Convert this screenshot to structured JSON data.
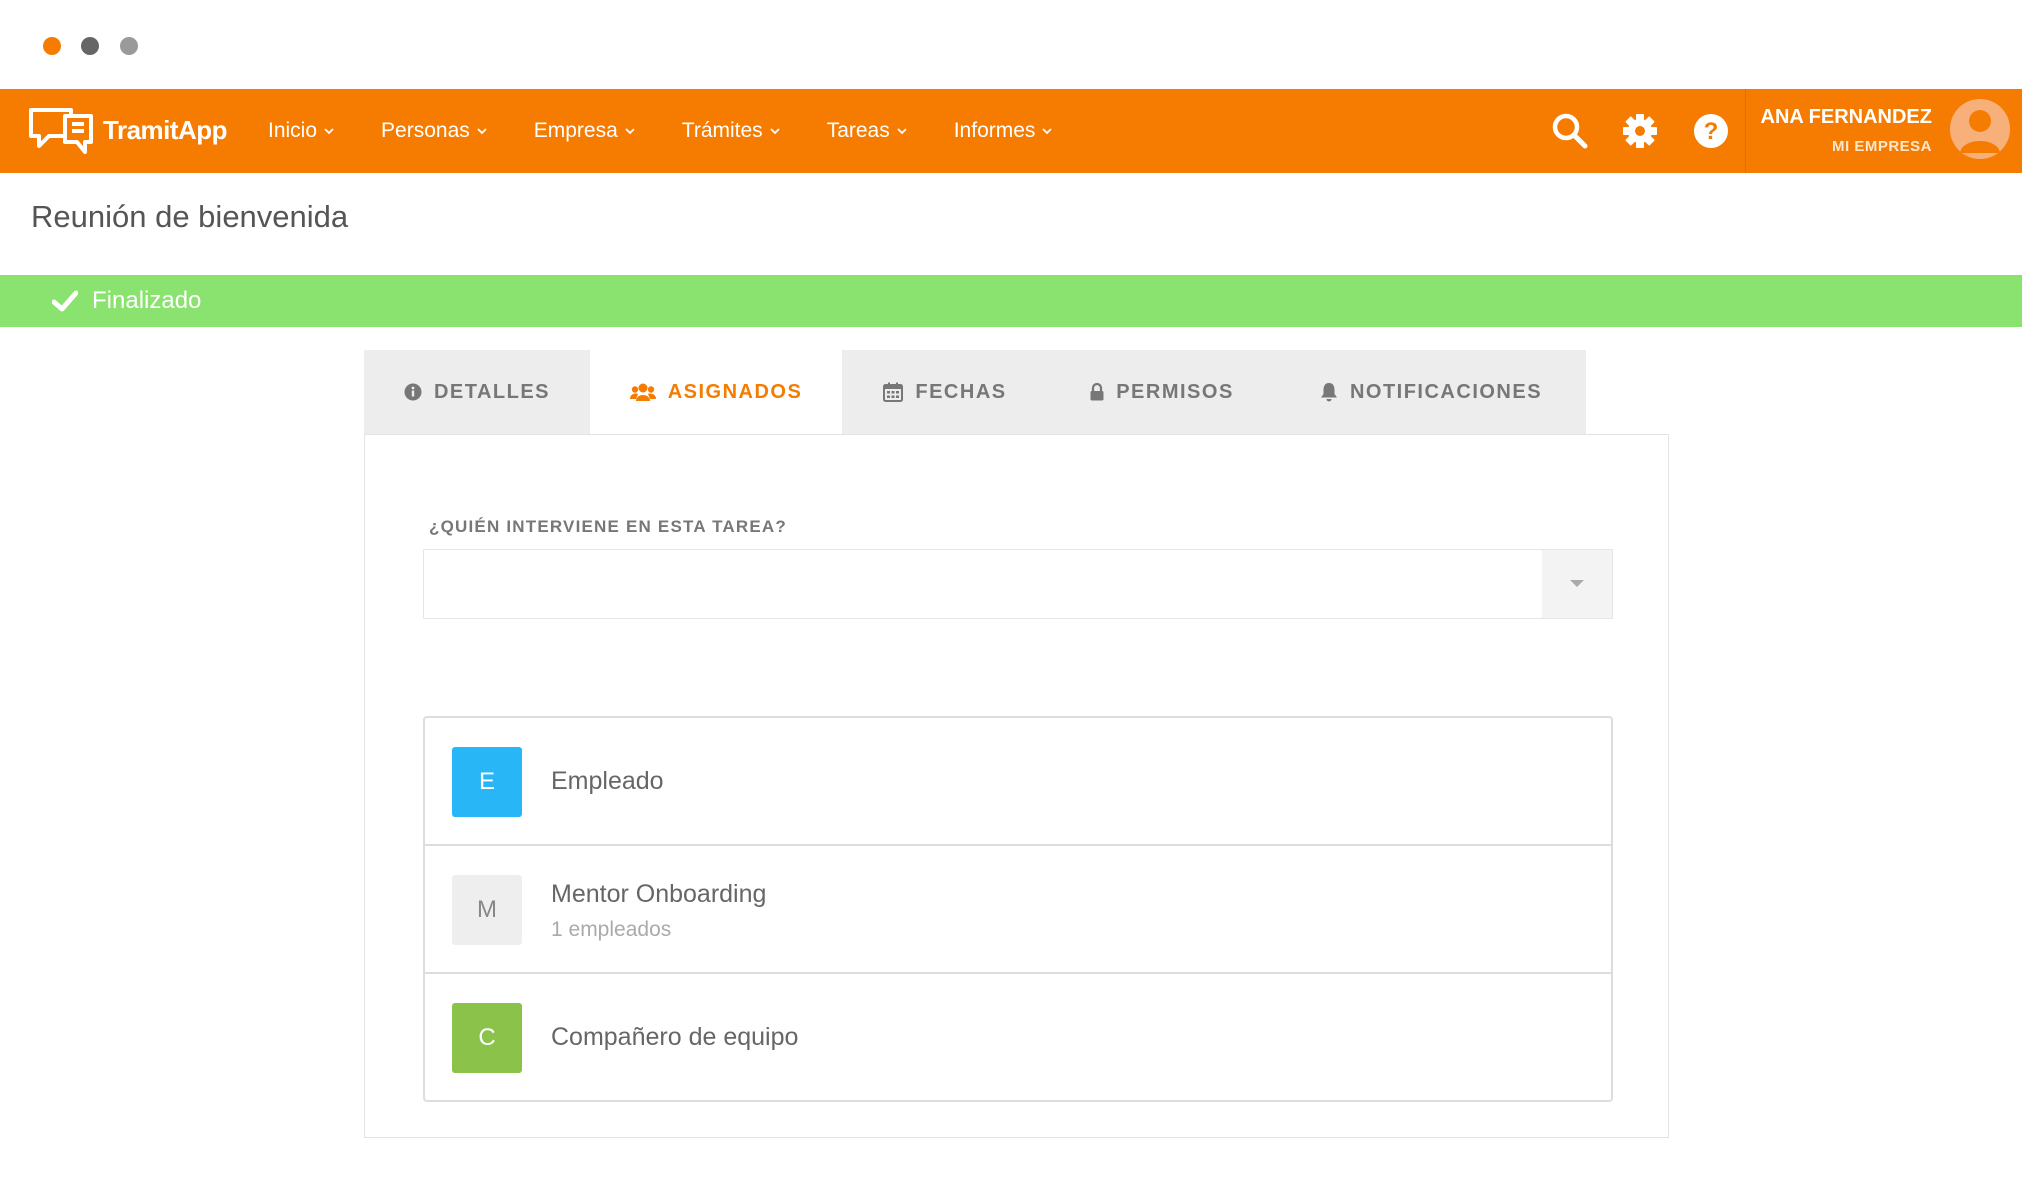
{
  "app": {
    "logo_text": "TramitApp",
    "colors": {
      "brand": "#f57c00",
      "success": "#8ae36e"
    }
  },
  "window": {
    "controls": [
      "close",
      "minimize",
      "maximize"
    ]
  },
  "nav": {
    "items": [
      {
        "label": "Inicio"
      },
      {
        "label": "Personas"
      },
      {
        "label": "Empresa"
      },
      {
        "label": "Trámites"
      },
      {
        "label": "Tareas"
      },
      {
        "label": "Informes"
      }
    ],
    "icons": [
      "search-icon",
      "gear-icon",
      "help-icon"
    ]
  },
  "user": {
    "name": "ANA FERNANDEZ",
    "company": "MI EMPRESA"
  },
  "page": {
    "title": "Reunión de bienvenida"
  },
  "status": {
    "label": "Finalizado"
  },
  "tabs": [
    {
      "label": "DETALLES",
      "icon": "info-icon"
    },
    {
      "label": "ASIGNADOS",
      "icon": "users-icon"
    },
    {
      "label": "FECHAS",
      "icon": "calendar-icon"
    },
    {
      "label": "PERMISOS",
      "icon": "lock-icon"
    },
    {
      "label": "NOTIFICACIONES",
      "icon": "bell-icon"
    }
  ],
  "active_tab": "ASIGNADOS",
  "form": {
    "label": "¿QUIÉN INTERVIENE EN ESTA TAREA?",
    "select_value": ""
  },
  "assignees": [
    {
      "initial": "E",
      "name": "Empleado",
      "sub": "",
      "color": "#29b6f6",
      "text_color": "#ffffff"
    },
    {
      "initial": "M",
      "name": "Mentor Onboarding",
      "sub": "1 empleados",
      "color": "#eeeeee",
      "text_color": "#888888"
    },
    {
      "initial": "C",
      "name": "Compañero de equipo",
      "sub": "",
      "color": "#8bc34a",
      "text_color": "#ffffff"
    }
  ]
}
